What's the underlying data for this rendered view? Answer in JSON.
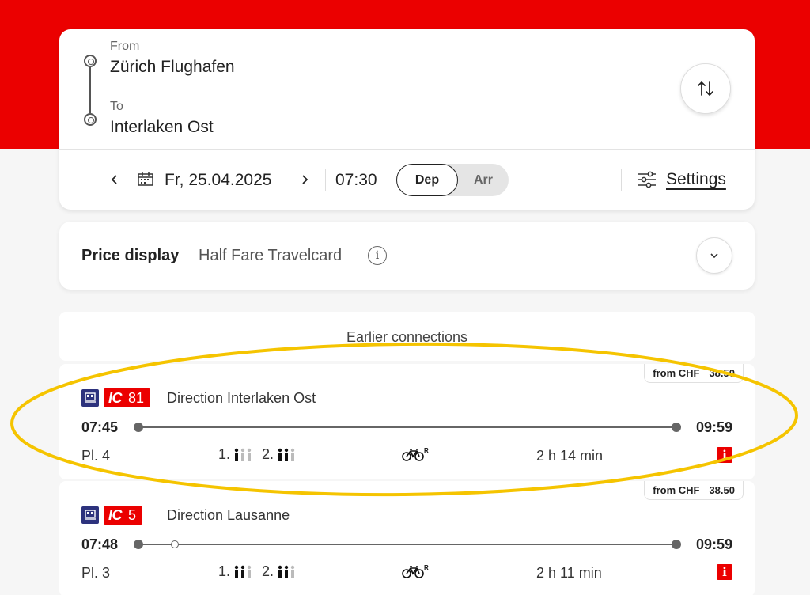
{
  "search": {
    "from_label": "From",
    "from_value": "Zürich Flughafen",
    "to_label": "To",
    "to_value": "Interlaken Ost",
    "date": "Fr, 25.04.2025",
    "time": "07:30",
    "dep_label": "Dep",
    "arr_label": "Arr",
    "selected_mode": "Dep",
    "settings_label": "Settings"
  },
  "price_display": {
    "title": "Price display",
    "value": "Half Fare Travelcard",
    "info_glyph": "i"
  },
  "earlier_label": "Earlier connections",
  "connections": [
    {
      "price_prefix": "from CHF",
      "price": "38.50",
      "train_category": "IC",
      "train_number": "81",
      "direction": "Direction Interlaken Ost",
      "departure": "07:45",
      "arrival": "09:59",
      "platform": "Pl. 4",
      "first_class": "1.",
      "second_class": "2.",
      "first_class_occupancy": 1,
      "second_class_occupancy": 2,
      "duration": "2 h 14 min",
      "info_glyph": "i",
      "bike_suffix": "R"
    },
    {
      "price_prefix": "from CHF",
      "price": "38.50",
      "train_category": "IC",
      "train_number": "5",
      "direction": "Direction Lausanne",
      "departure": "07:48",
      "arrival": "09:59",
      "platform": "Pl. 3",
      "first_class": "1.",
      "second_class": "2.",
      "first_class_occupancy": 2,
      "second_class_occupancy": 2,
      "duration": "2 h 11 min",
      "info_glyph": "i",
      "bike_suffix": "R"
    }
  ],
  "colors": {
    "brand_red": "#eb0000",
    "train_blue": "#2d327d",
    "highlight_yellow": "#f5c400"
  },
  "icons": [
    "swap-icon",
    "calendar-icon",
    "chevron-left-icon",
    "chevron-right-icon",
    "settings-sliders-icon",
    "info-icon",
    "chevron-down-icon",
    "train-icon",
    "bike-icon",
    "occupancy-icon"
  ]
}
